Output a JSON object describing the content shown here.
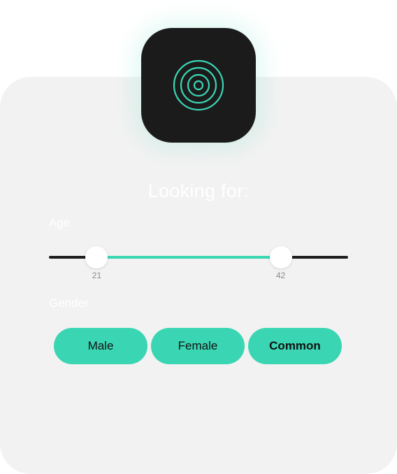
{
  "colors": {
    "accent": "#3ad6b4",
    "card_bg": "#f2f2f2",
    "icon_bg": "#1b1b1b",
    "track_dark": "#1e1e1e"
  },
  "app_icon": {
    "icon": "radar-target-icon"
  },
  "title": "Looking for:",
  "age": {
    "label": "Age",
    "min_value": "21",
    "max_value": "42",
    "range_low_fraction": 0.16,
    "range_high_fraction": 0.775
  },
  "gender": {
    "label": "Gender",
    "options": [
      {
        "label": "Male",
        "selected": false
      },
      {
        "label": "Female",
        "selected": false
      },
      {
        "label": "Common",
        "selected": true
      }
    ]
  }
}
